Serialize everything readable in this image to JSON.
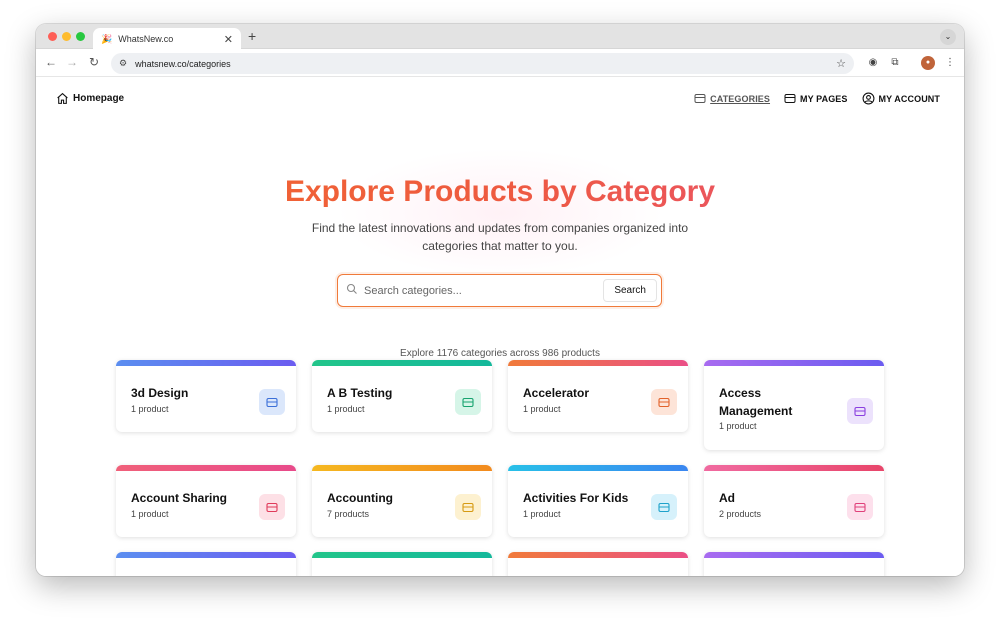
{
  "browser": {
    "tab_title": "WhatsNew.co",
    "tab_favicon": "🎉",
    "url": "whatsnew.co/categories"
  },
  "nav": {
    "home_label": "Homepage",
    "links": [
      {
        "label": "CATEGORIES",
        "icon": "inbox-icon",
        "active": true
      },
      {
        "label": "MY PAGES",
        "icon": "inbox-icon",
        "active": false
      },
      {
        "label": "MY ACCOUNT",
        "icon": "user-circle-icon",
        "active": false
      }
    ]
  },
  "hero": {
    "title": "Explore Products by Category",
    "subtitle": "Find the latest innovations and updates from companies organized into categories that matter to you."
  },
  "search": {
    "placeholder": "Search categories...",
    "button_label": "Search"
  },
  "stats_text": "Explore 1176 categories across 986 products",
  "categories": [
    {
      "name": "3d Design",
      "count": "1 product",
      "gradient": [
        "#5b8ef0",
        "#6b5cf0"
      ],
      "icon_bg": "#dbe7fb",
      "icon_color": "#3b6fd8"
    },
    {
      "name": "A B Testing",
      "count": "1 product",
      "gradient": [
        "#22c58a",
        "#14b89b"
      ],
      "icon_bg": "#d6f5e8",
      "icon_color": "#17a36f"
    },
    {
      "name": "Accelerator",
      "count": "1 product",
      "gradient": [
        "#f07a3a",
        "#ea4f86"
      ],
      "icon_bg": "#fde4d8",
      "icon_color": "#e2622a"
    },
    {
      "name": "Access Management",
      "count": "1 product",
      "gradient": [
        "#a86bf0",
        "#6b5cf0"
      ],
      "icon_bg": "#ece2fc",
      "icon_color": "#8a3fe0"
    },
    {
      "name": "Account Sharing",
      "count": "1 product",
      "gradient": [
        "#f0607a",
        "#e84a8a"
      ],
      "icon_bg": "#fde0e6",
      "icon_color": "#e03a5a"
    },
    {
      "name": "Accounting",
      "count": "7 products",
      "gradient": [
        "#f5b820",
        "#f28a1e"
      ],
      "icon_bg": "#fdf1d0",
      "icon_color": "#d69a12"
    },
    {
      "name": "Activities For Kids",
      "count": "1 product",
      "gradient": [
        "#28c0e8",
        "#3a86f0"
      ],
      "icon_bg": "#d6f1fb",
      "icon_color": "#1ea2cb"
    },
    {
      "name": "Ad",
      "count": "2 products",
      "gradient": [
        "#f06aa0",
        "#e8456a"
      ],
      "icon_bg": "#fde0ec",
      "icon_color": "#e0407a"
    },
    {
      "name": "",
      "count": "",
      "gradient": [
        "#5b8ef0",
        "#6b5cf0"
      ],
      "icon_bg": "#dbe7fb",
      "icon_color": "#3b6fd8"
    },
    {
      "name": "",
      "count": "",
      "gradient": [
        "#22c58a",
        "#14b89b"
      ],
      "icon_bg": "#d6f5e8",
      "icon_color": "#17a36f"
    },
    {
      "name": "",
      "count": "",
      "gradient": [
        "#f07a3a",
        "#ea4f86"
      ],
      "icon_bg": "#fde4d8",
      "icon_color": "#e2622a"
    },
    {
      "name": "",
      "count": "",
      "gradient": [
        "#a86bf0",
        "#6b5cf0"
      ],
      "icon_bg": "#ece2fc",
      "icon_color": "#8a3fe0"
    }
  ]
}
